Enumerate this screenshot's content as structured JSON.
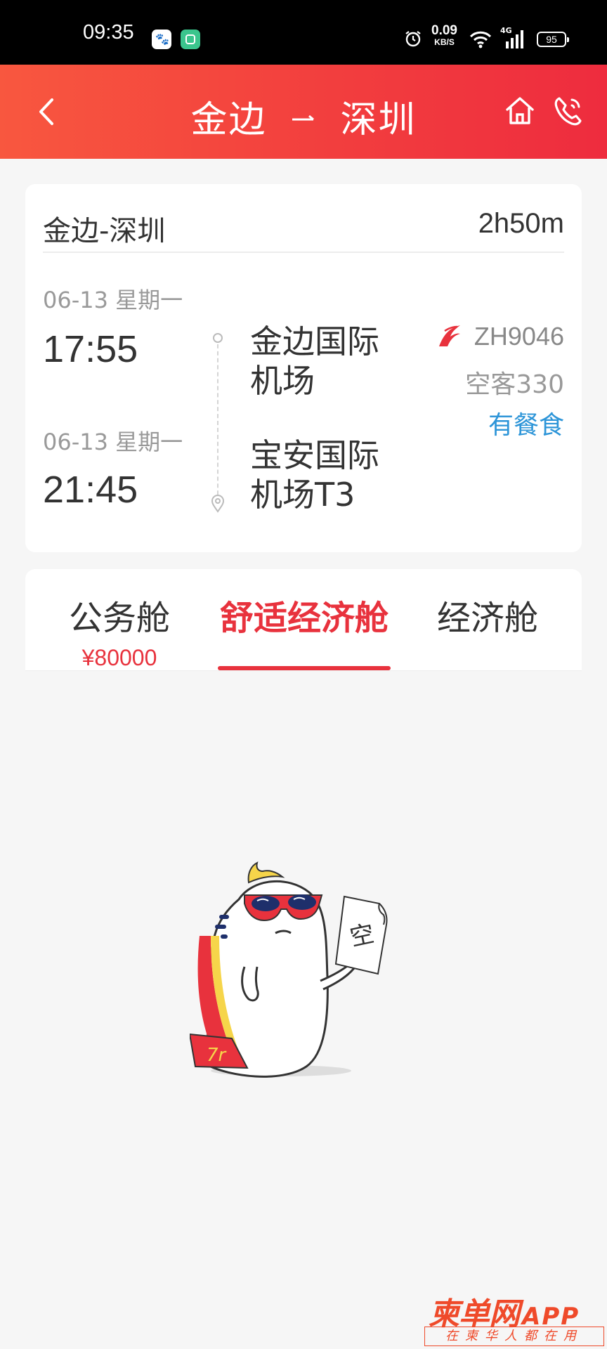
{
  "status_bar": {
    "time": "09:35",
    "net_speed_value": "0.09",
    "net_speed_unit": "KB/S",
    "signal_label": "4G",
    "battery": "95"
  },
  "navbar": {
    "origin": "金边",
    "destination": "深圳"
  },
  "flight": {
    "route": "金边-深圳",
    "duration": "2h50m",
    "depart_date": "06-13 星期一",
    "depart_time": "17:55",
    "depart_airport": "金边国际机场",
    "arrive_date": "06-13 星期一",
    "arrive_time": "21:45",
    "arrive_airport": "宝安国际机场T3",
    "flight_no": "ZH9046",
    "aircraft": "空客330",
    "meal": "有餐食"
  },
  "cabins": {
    "tabs": [
      {
        "label": "公务舱",
        "price": "¥80000"
      },
      {
        "label": "舒适经济舱",
        "price": ""
      },
      {
        "label": "经济舱",
        "price": ""
      }
    ],
    "selected_index": 1
  },
  "empty_state": {
    "sign_text": "空"
  },
  "watermark": {
    "brand": "柬单网",
    "app": "APP",
    "slogan": "在柬华人都在用"
  },
  "colors": {
    "accent": "#e8323d",
    "meal": "#2d95d8",
    "nav_start": "#f8573f",
    "nav_end": "#ee2c3e"
  }
}
